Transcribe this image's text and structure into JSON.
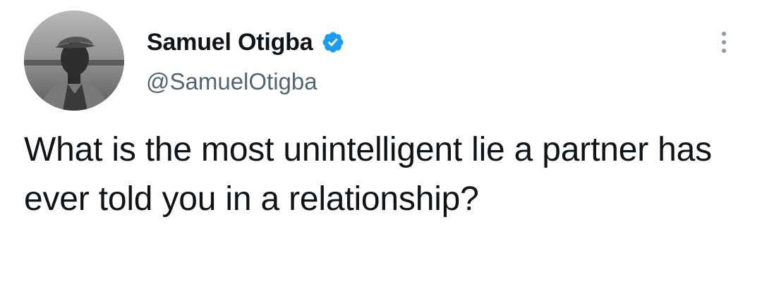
{
  "author": {
    "display_name": "Samuel Otigba",
    "handle": "@SamuelOtigba",
    "verified": true,
    "avatar_icon": "profile-photo"
  },
  "tweet": {
    "text": "What is the most unintelligent lie a partner has ever told you in a relationship?"
  },
  "actions": {
    "more_icon": "more-options-icon"
  },
  "colors": {
    "verified_badge": "#1d9bf0",
    "handle": "#536471",
    "text": "#0f1419"
  }
}
